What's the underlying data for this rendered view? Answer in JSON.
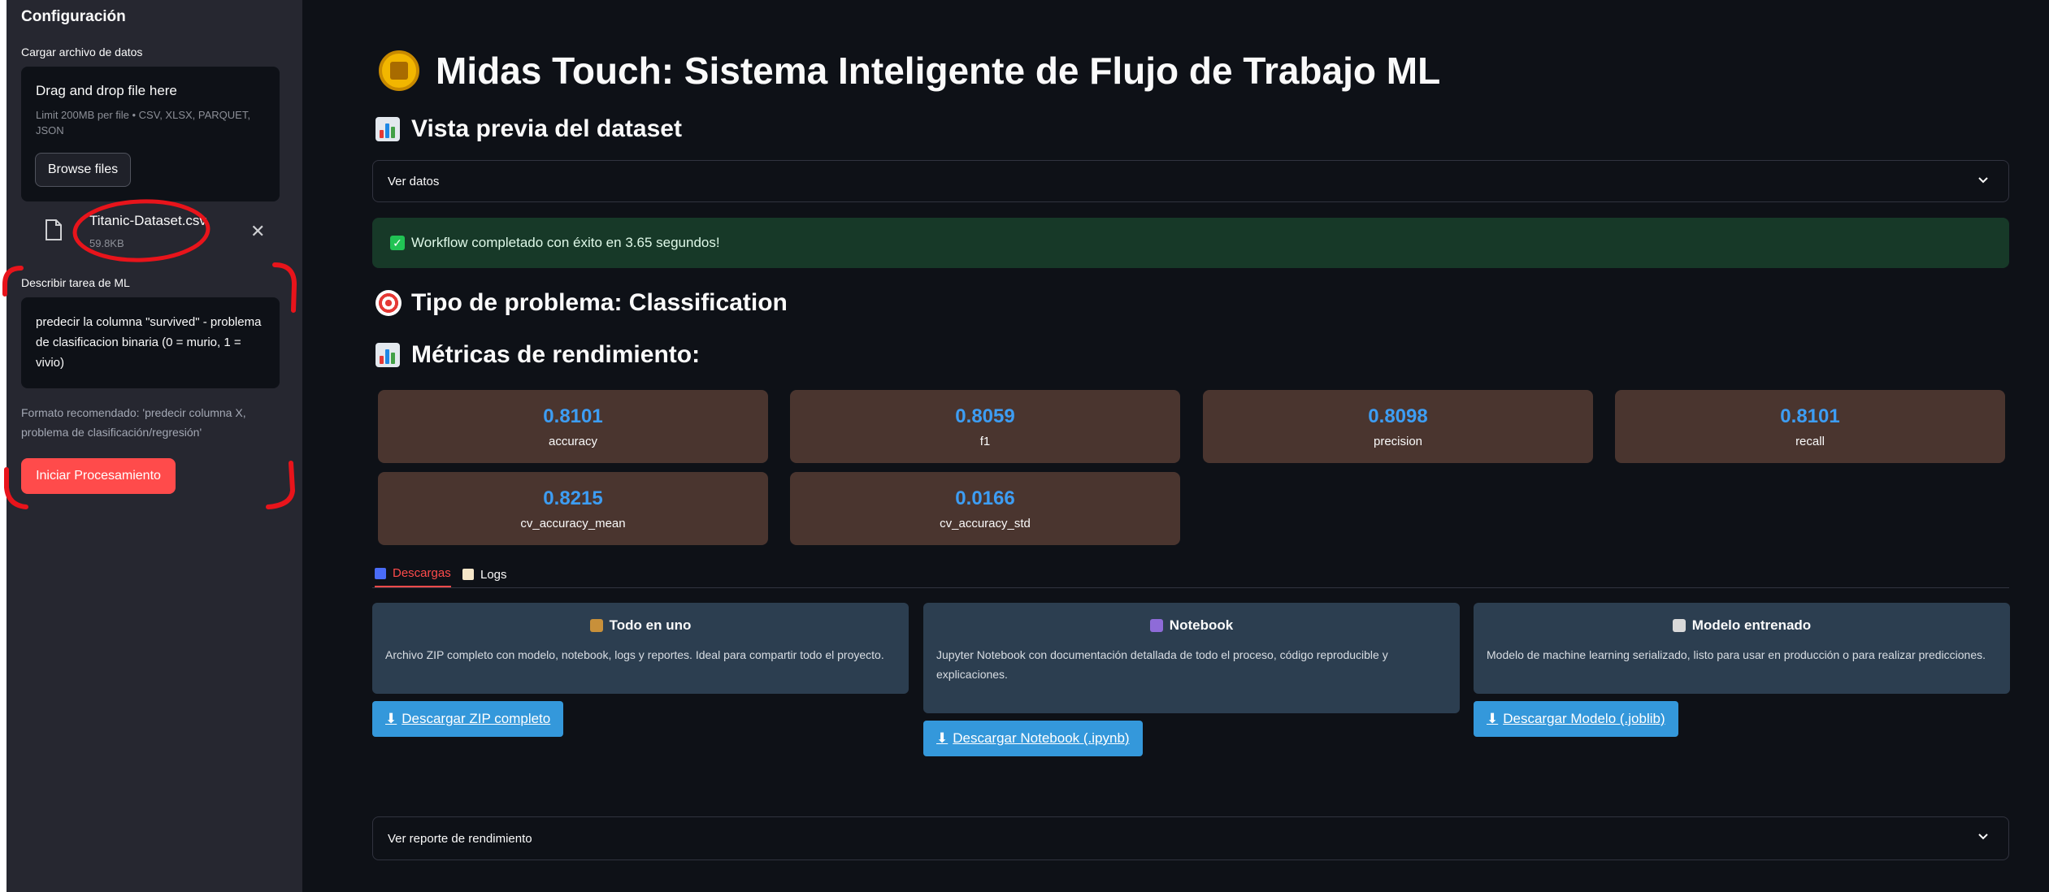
{
  "sidebar": {
    "title": "Configuración",
    "upload_label": "Cargar archivo de datos",
    "dropzone_title": "Drag and drop file here",
    "dropzone_limit": "Limit 200MB per file • CSV, XLSX, PARQUET, JSON",
    "browse_label": "Browse files",
    "file": {
      "name": "Titanic-Dataset.csv",
      "size": "59.8KB"
    },
    "task_label": "Describir tarea de ML",
    "task_text": "predecir la columna \"survived\" - problema de clasificacion binaria (0 = murio, 1 = vivio)",
    "hint": "Formato recomendado: 'predecir columna X, problema de clasificación/regresión'",
    "start_label": "Iniciar Procesamiento"
  },
  "main": {
    "title": "Midas Touch: Sistema Inteligente de Flujo de Trabajo ML",
    "preview_heading": "Vista previa del dataset",
    "preview_expander": "Ver datos",
    "success_msg": "Workflow completado con éxito en 3.65 segundos!",
    "problem_heading": "Tipo de problema: Classification",
    "metrics_heading": "Métricas de rendimiento:",
    "metrics": [
      {
        "value": "0.8101",
        "label": "accuracy"
      },
      {
        "value": "0.8059",
        "label": "f1"
      },
      {
        "value": "0.8098",
        "label": "precision"
      },
      {
        "value": "0.8101",
        "label": "recall"
      },
      {
        "value": "0.8215",
        "label": "cv_accuracy_mean"
      },
      {
        "value": "0.0166",
        "label": "cv_accuracy_std"
      }
    ],
    "tabs": [
      {
        "label": "Descargas"
      },
      {
        "label": "Logs"
      }
    ],
    "cards": [
      {
        "title": "Todo en uno",
        "desc": "Archivo ZIP completo con modelo, notebook, logs y reportes. Ideal para compartir todo el proyecto.",
        "button": "Descargar ZIP completo"
      },
      {
        "title": "Notebook",
        "desc": "Jupyter Notebook con documentación detallada de todo el proceso, código reproducible y explicaciones.",
        "button": "Descargar Notebook (.ipynb)"
      },
      {
        "title": "Modelo entrenado",
        "desc": "Modelo de machine learning serializado, listo para usar en producción o para realizar predicciones.",
        "button": "Descargar Modelo (.joblib)"
      }
    ],
    "report_expander": "Ver reporte de rendimiento"
  },
  "colors": {
    "background": "#0e1117",
    "sidebar": "#262730",
    "accent_red": "#ff4b4b",
    "metric_value": "#3d9df3",
    "metric_card": "#4a352f",
    "success_bg": "#173928",
    "download_card": "#2c3e50",
    "download_button": "#3498db",
    "annotation": "#e8141b"
  }
}
